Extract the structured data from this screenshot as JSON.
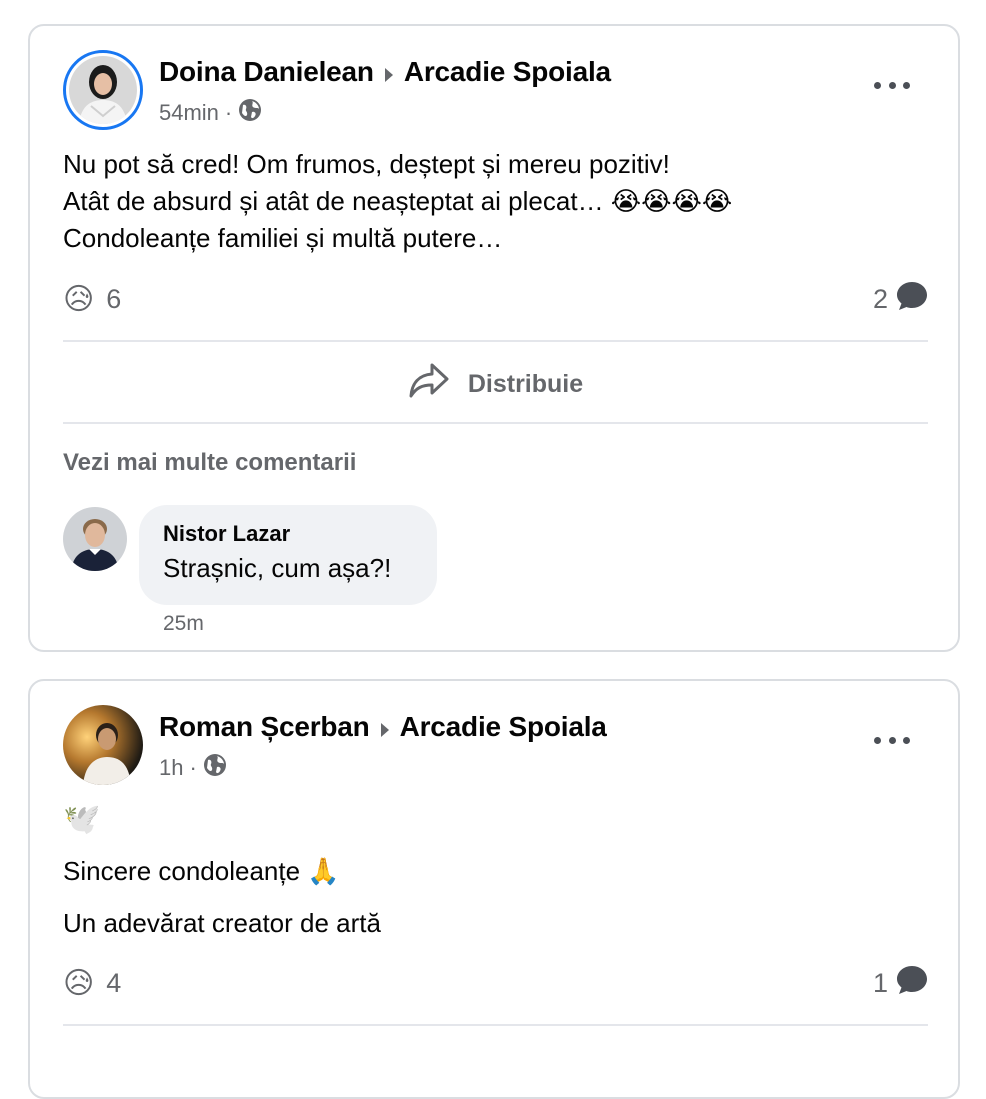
{
  "posts": [
    {
      "author": "Doina Danielean",
      "target": "Arcadie Spoiala",
      "time": "54min",
      "separator": "·",
      "privacy_icon": "globe-icon",
      "text_lines": [
        "Nu pot să cred! Om frumos, deștept și mereu pozitiv!",
        "Atât de absurd și atât de neașteptat ai plecat… 😭😭😭😭",
        "Condoleanțe familiei și multă putere…"
      ],
      "reaction_emoji": "😥",
      "reaction_count": "6",
      "comment_count": "2",
      "share_label": "Distribuie",
      "see_more_comments": "Vezi mai multe comentarii",
      "comment": {
        "author": "Nistor Lazar",
        "text": "Strașnic, cum așa?!",
        "time": "25m"
      }
    },
    {
      "author": "Roman Șcerban",
      "target": "Arcadie Spoiala",
      "time": "1h",
      "separator": "·",
      "privacy_icon": "globe-icon",
      "dove_emoji": "🕊️",
      "text_lines": [
        "Sincere condoleanțe 🙏",
        "Un adevărat creator de artă"
      ],
      "reaction_emoji": "😥",
      "reaction_count": "4",
      "comment_count": "1"
    }
  ],
  "colors": {
    "accent": "#1877f2",
    "secondary_text": "#65676b",
    "bubble": "#f0f2f5",
    "divider": "#e4e6eb"
  }
}
